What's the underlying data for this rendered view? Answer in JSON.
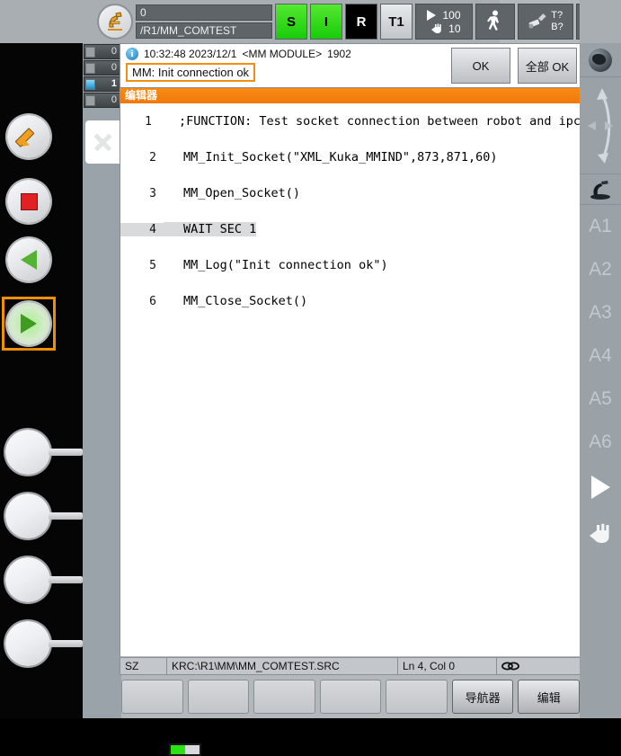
{
  "top_bar": {
    "robot_icon": "kuka-robot-icon",
    "program_number": "0",
    "program_path": "/R1/MM_COMTEST",
    "indicators": [
      {
        "label": "S",
        "state": "green"
      },
      {
        "label": "I",
        "state": "green"
      },
      {
        "label": "R",
        "state": "black"
      },
      {
        "label": "T1",
        "state": "grey"
      }
    ],
    "override": {
      "program_icon": "play-triangle-icon",
      "program_value": "100",
      "jog_icon": "hand-jog-icon",
      "jog_value": "10"
    },
    "mode_icon": "walking-person-icon",
    "tool_base": {
      "icon": "tool-base-icon",
      "tool": "T?",
      "base": "B?"
    },
    "step_icon": "step-mode-icon",
    "infinity": "∞"
  },
  "status_counters": [
    {
      "icon": "ack-message-icon",
      "count": "0",
      "active": false
    },
    {
      "icon": "warning-message-icon",
      "count": "0",
      "active": false
    },
    {
      "icon": "info-message-icon",
      "count": "1",
      "active": true
    },
    {
      "icon": "dialog-message-icon",
      "count": "0",
      "active": false
    }
  ],
  "side_tools": {
    "close_icon": "close-x-icon",
    "items": [
      {
        "icon": "config-gear-icon"
      },
      {
        "icon": "clock-icon"
      },
      {
        "icon": "user-group-icon"
      }
    ]
  },
  "message": {
    "info_icon": "info-icon",
    "timestamp": "10:32:48 2023/12/1",
    "source": "<MM MODULE>",
    "code": "1902",
    "text": "MM: Init connection ok",
    "ok_label": "OK",
    "ok_all_label": "全部 OK",
    "highlight_color": "#f0900d"
  },
  "editor": {
    "header_title": "编辑器",
    "header_color": "#f0780a",
    "selected_line": 4,
    "lines": [
      {
        "num": "1",
        "text": ";FUNCTION: Test socket connection between robot and ipc"
      },
      {
        "num": "2",
        "text": "MM_Init_Socket(\"XML_Kuka_MMIND\",873,871,60)"
      },
      {
        "num": "3",
        "text": "MM_Open_Socket()"
      },
      {
        "num": "4",
        "text": "WAIT SEC 1"
      },
      {
        "num": "5",
        "text": "MM_Log(\"Init connection ok\")"
      },
      {
        "num": "6",
        "text": "MM_Close_Socket()"
      }
    ]
  },
  "status_bar": {
    "mode": "SZ",
    "file_path": "KRC:\\R1\\MM\\MM_COMTEST.SRC",
    "cursor": "Ln 4, Col 0",
    "link_icon": "chain-link-icon"
  },
  "softkeys": [
    {
      "label": "",
      "strong": false
    },
    {
      "label": "",
      "strong": false
    },
    {
      "label": "",
      "strong": false
    },
    {
      "label": "",
      "strong": false
    },
    {
      "label": "",
      "strong": false
    },
    {
      "label": "导航器",
      "strong": true
    },
    {
      "label": "编辑",
      "strong": true
    }
  ],
  "right_sidebar": {
    "globe_icon": "world-coordinate-globe-icon",
    "move_icon": "jog-direction-arrows-icon",
    "robot_icon": "robot-axis-icon",
    "axes": [
      "A1",
      "A2",
      "A3",
      "A4",
      "A5",
      "A6"
    ],
    "play_icon": "play-triangle-icon",
    "hand_icon": "hand-jog-icon"
  },
  "hardware_buttons": [
    {
      "icon": "edit-pencil-icon",
      "selected": false
    },
    {
      "icon": "stop-square-icon",
      "selected": false
    },
    {
      "icon": "start-backward-icon",
      "selected": false
    },
    {
      "icon": "start-forward-icon",
      "selected": true
    }
  ],
  "battery": {
    "icon": "battery-icon",
    "level_percent": 50,
    "color": "#2ee016"
  }
}
